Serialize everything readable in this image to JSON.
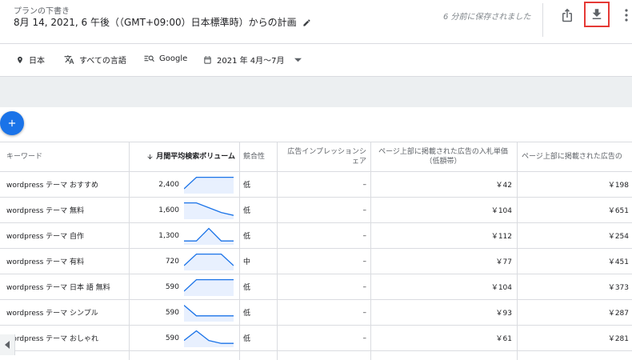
{
  "header": {
    "plan_label": "プランの下書き",
    "plan_title": "8月 14, 2021, 6 午後（（GMT+09:00）日本標準時）からの計画",
    "saved_status": "6 分前に保存されました"
  },
  "filters": {
    "location": "日本",
    "language": "すべての言語",
    "network": "Google",
    "date_range": "2021 年 4月～7月"
  },
  "table": {
    "columns": {
      "keyword": "キーワード",
      "avg_searches": "月間平均検索ボリューム",
      "competition": "競合性",
      "impression_share": "広告インプレッションシェア",
      "bid_low": "ページ上部に掲載された広告の入札単価（低額帯）",
      "bid_high": "ページ上部に掲載された広告の"
    },
    "rows": [
      {
        "keyword": "wordpress テーマ おすすめ",
        "volume": "2,400",
        "competition": "低",
        "share": "–",
        "bid_low": "￥42",
        "bid_high": "￥198",
        "trend": [
          0.25,
          0.85,
          0.85,
          0.85,
          0.85
        ]
      },
      {
        "keyword": "wordpress テーマ 無料",
        "volume": "1,600",
        "competition": "低",
        "share": "–",
        "bid_low": "￥104",
        "bid_high": "￥651",
        "trend": [
          0.85,
          0.85,
          0.6,
          0.35,
          0.2
        ]
      },
      {
        "keyword": "wordpress テーマ 自作",
        "volume": "1,300",
        "competition": "低",
        "share": "–",
        "bid_low": "￥112",
        "bid_high": "￥254",
        "trend": [
          0.2,
          0.2,
          0.85,
          0.2,
          0.2
        ]
      },
      {
        "keyword": "wordpress テーマ 有料",
        "volume": "720",
        "competition": "中",
        "share": "–",
        "bid_low": "￥77",
        "bid_high": "￥451",
        "trend": [
          0.25,
          0.85,
          0.85,
          0.85,
          0.25
        ]
      },
      {
        "keyword": "wordpress テーマ 日本 語 無料",
        "volume": "590",
        "competition": "低",
        "share": "–",
        "bid_low": "￥104",
        "bid_high": "￥373",
        "trend": [
          0.25,
          0.85,
          0.85,
          0.85,
          0.85
        ]
      },
      {
        "keyword": "wordpress テーマ シンプル",
        "volume": "590",
        "competition": "低",
        "share": "–",
        "bid_low": "￥93",
        "bid_high": "￥287",
        "trend": [
          0.85,
          0.3,
          0.3,
          0.3,
          0.3
        ]
      },
      {
        "keyword": "wordpress テーマ おしゃれ",
        "volume": "590",
        "competition": "低",
        "share": "–",
        "bid_low": "￥61",
        "bid_high": "￥281",
        "trend": [
          0.35,
          0.85,
          0.35,
          0.2,
          0.2
        ]
      }
    ]
  },
  "colors": {
    "accent": "#1a73e8",
    "highlight_border": "#e53935",
    "sparkline": "#1a73e8",
    "sparkline_fill": "#e8f0fe"
  },
  "icons": [
    "location-pin-icon",
    "translate-icon",
    "search-network-icon",
    "calendar-icon",
    "share-icon",
    "download-icon",
    "more-vert-icon",
    "add-icon",
    "sort-arrow-icon",
    "pencil-icon"
  ]
}
